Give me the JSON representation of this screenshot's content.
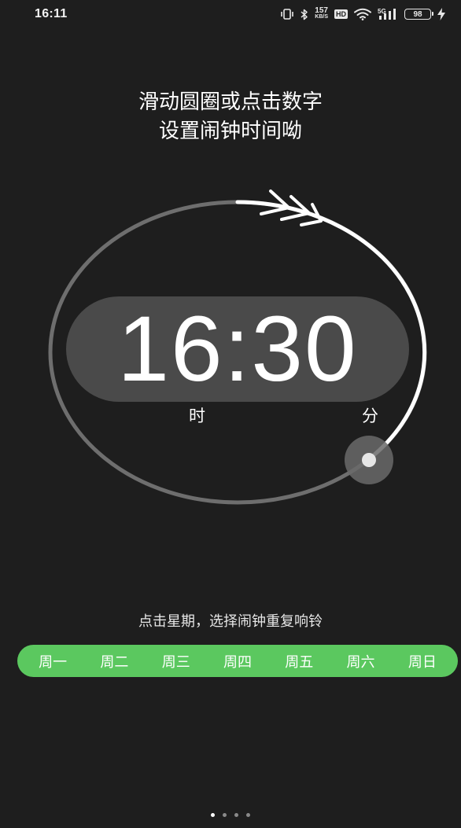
{
  "status_bar": {
    "time": "16:11",
    "net_speed_value": "157",
    "net_speed_unit": "KB/S",
    "hd_label": "HD",
    "network_label": "5G",
    "battery_level": "98"
  },
  "instruction": {
    "line1": "滑动圆圈或点击数字",
    "line2": "设置闹钟时间呦"
  },
  "alarm": {
    "hour": "16",
    "separator": ":",
    "minute": "30",
    "hour_unit": "时",
    "minute_unit": "分"
  },
  "repeat": {
    "hint": "点击星期，选择闹钟重复响铃",
    "days": [
      "周一",
      "周二",
      "周三",
      "周四",
      "周五",
      "周六",
      "周日"
    ]
  },
  "pager": {
    "count": 4,
    "active_index": 0
  },
  "colors": {
    "background": "#1e1e1e",
    "accent_green": "#5bc85f",
    "pill": "#4a4a4a",
    "ring_track": "#6e6e6e",
    "ring_progress": "#ffffff"
  }
}
